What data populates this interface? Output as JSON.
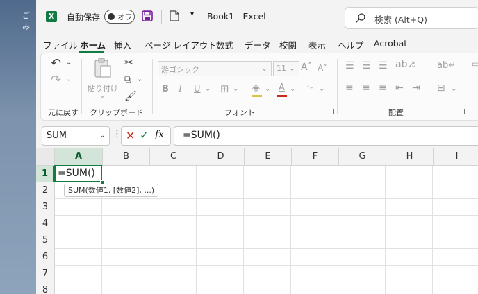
{
  "desktop": {
    "label": "ごみ"
  },
  "titlebar": {
    "app_logo": "X",
    "autosave_label": "自動保存",
    "autosave_state": "オフ",
    "title": "Book1  -  Excel",
    "search_placeholder": "検索 (Alt+Q)"
  },
  "menu": [
    "ファイル",
    "ホーム",
    "挿入",
    "ページ レイアウト",
    "数式",
    "データ",
    "校閲",
    "表示",
    "ヘルプ",
    "Acrobat"
  ],
  "ribbon": {
    "undo_group_label": "元に戻す",
    "paste_label": "貼り付け",
    "clipboard_group_label": "クリップボード",
    "font_name": "游ゴシック",
    "font_size": "11",
    "font_group_label": "フォント",
    "align_group_label": "配置"
  },
  "formula_bar": {
    "name_box": "SUM",
    "formula": "=SUM()",
    "fx": "fx"
  },
  "sheet": {
    "columns": [
      "A",
      "B",
      "C",
      "D",
      "E",
      "F",
      "G",
      "H",
      "I"
    ],
    "rows": [
      "1",
      "2",
      "3",
      "4",
      "5",
      "6",
      "7",
      "8"
    ],
    "active_cell_content": "=SUM()",
    "tooltip": "SUM(数値1, [数値2], ...)"
  },
  "colors": {
    "accent": "#107c41",
    "cancel": "#c42b1c"
  }
}
